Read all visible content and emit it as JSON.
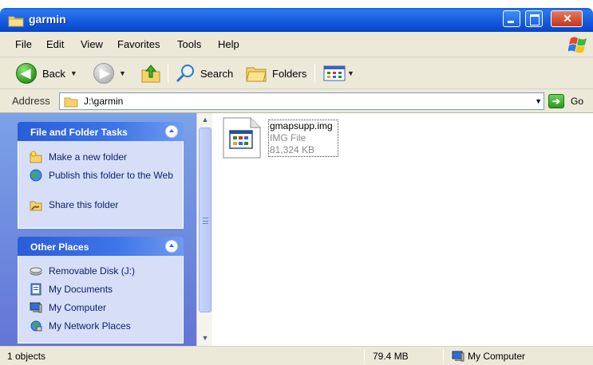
{
  "window": {
    "title": "garmin"
  },
  "menu": [
    "File",
    "Edit",
    "View",
    "Favorites",
    "Tools",
    "Help"
  ],
  "toolbar": {
    "back_label": "Back",
    "search_label": "Search",
    "folders_label": "Folders"
  },
  "address": {
    "label": "Address",
    "value": "J:\\garmin",
    "go_label": "Go"
  },
  "tasks_panel": {
    "title": "File and Folder Tasks",
    "items": [
      {
        "label": "Make a new folder",
        "icon": "new-folder-icon"
      },
      {
        "label": "Publish this folder to the Web",
        "icon": "globe-icon"
      },
      {
        "label": "Share this folder",
        "icon": "share-folder-icon"
      }
    ]
  },
  "places_panel": {
    "title": "Other Places",
    "items": [
      {
        "label": "Removable Disk (J:)",
        "icon": "removable-disk-icon"
      },
      {
        "label": "My Documents",
        "icon": "my-documents-icon"
      },
      {
        "label": "My Computer",
        "icon": "my-computer-icon"
      },
      {
        "label": "My Network Places",
        "icon": "network-places-icon"
      }
    ]
  },
  "files": [
    {
      "name": "gmapsupp.img",
      "type": "IMG File",
      "size": "81,324 KB"
    }
  ],
  "status": {
    "objects": "1 objects",
    "size": "79.4 MB",
    "location": "My Computer"
  },
  "colors": {
    "titlebar": "#0b4fd6",
    "taskpane": "#6f8fe0",
    "link": "#0b1d6e"
  }
}
